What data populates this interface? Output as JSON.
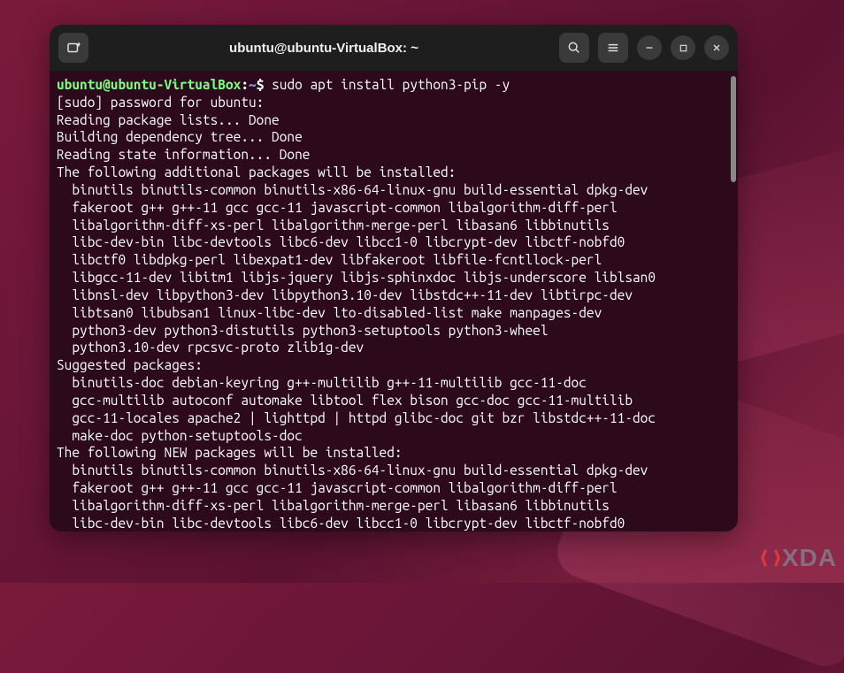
{
  "window": {
    "title": "ubuntu@ubuntu-VirtualBox: ~"
  },
  "prompt": {
    "user_host": "ubuntu@ubuntu-VirtualBox",
    "sep1": ":",
    "path": "~",
    "sep2": "$ ",
    "command": "sudo apt install python3-pip -y"
  },
  "output": [
    "[sudo] password for ubuntu:",
    "Reading package lists... Done",
    "Building dependency tree... Done",
    "Reading state information... Done",
    "The following additional packages will be installed:"
  ],
  "additional_packages": [
    "binutils binutils-common binutils-x86-64-linux-gnu build-essential dpkg-dev",
    "fakeroot g++ g++-11 gcc gcc-11 javascript-common libalgorithm-diff-perl",
    "libalgorithm-diff-xs-perl libalgorithm-merge-perl libasan6 libbinutils",
    "libc-dev-bin libc-devtools libc6-dev libcc1-0 libcrypt-dev libctf-nobfd0",
    "libctf0 libdpkg-perl libexpat1-dev libfakeroot libfile-fcntllock-perl",
    "libgcc-11-dev libitm1 libjs-jquery libjs-sphinxdoc libjs-underscore liblsan0",
    "libnsl-dev libpython3-dev libpython3.10-dev libstdc++-11-dev libtirpc-dev",
    "libtsan0 libubsan1 linux-libc-dev lto-disabled-list make manpages-dev",
    "python3-dev python3-distutils python3-setuptools python3-wheel",
    "python3.10-dev rpcsvc-proto zlib1g-dev"
  ],
  "suggested_header": "Suggested packages:",
  "suggested_packages": [
    "binutils-doc debian-keyring g++-multilib g++-11-multilib gcc-11-doc",
    "gcc-multilib autoconf automake libtool flex bison gcc-doc gcc-11-multilib",
    "gcc-11-locales apache2 | lighttpd | httpd glibc-doc git bzr libstdc++-11-doc",
    "make-doc python-setuptools-doc"
  ],
  "new_header": "The following NEW packages will be installed:",
  "new_packages": [
    "binutils binutils-common binutils-x86-64-linux-gnu build-essential dpkg-dev",
    "fakeroot g++ g++-11 gcc gcc-11 javascript-common libalgorithm-diff-perl",
    "libalgorithm-diff-xs-perl libalgorithm-merge-perl libasan6 libbinutils",
    "libc-dev-bin libc-devtools libc6-dev libcc1-0 libcrypt-dev libctf-nobfd0"
  ],
  "watermark": "XDA"
}
